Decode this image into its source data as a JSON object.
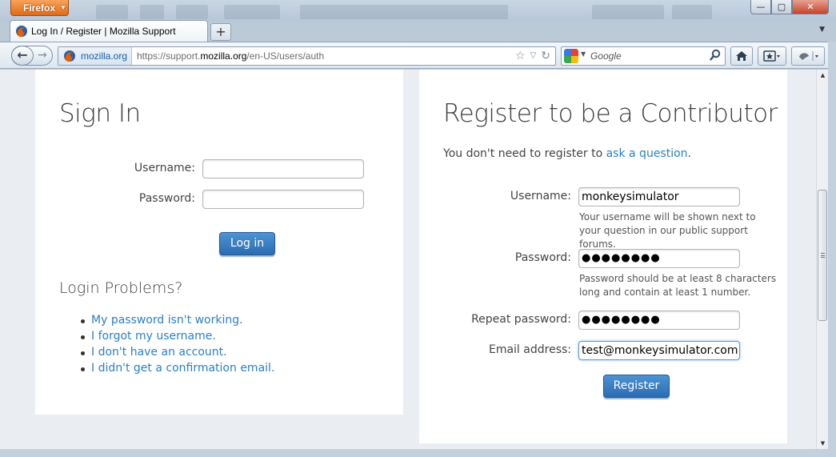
{
  "window": {
    "menu_label": "Firefox",
    "minimize": "—",
    "maximize": "▢",
    "close": "✕"
  },
  "tab": {
    "title": "Log In / Register | Mozilla Support",
    "new_tab": "+",
    "list_arrow": "▼"
  },
  "navbar": {
    "back": "←",
    "forward": "→",
    "identity": "mozilla.org",
    "url_prefix": "https://support.",
    "url_domain": "mozilla.org",
    "url_suffix": "/en-US/users/auth",
    "star": "☆",
    "history_drop": "▽",
    "reload": "↻",
    "search_placeholder": "Google",
    "search_drop": "▼",
    "search_go": "🔍"
  },
  "signin": {
    "title": "Sign In",
    "username_label": "Username:",
    "username_value": "",
    "password_label": "Password:",
    "password_value": "",
    "login_button": "Log in",
    "problems_title": "Login Problems?",
    "links": [
      "My password isn't working.",
      "I forgot my username.",
      "I don't have an account.",
      "I didn't get a confirmation email."
    ]
  },
  "register": {
    "title": "Register to be a Contributor",
    "intro_text": "You don't need to register to ",
    "intro_link": "ask a question",
    "intro_end": ".",
    "username_label": "Username:",
    "username_value": "monkeysimulator",
    "username_hint": "Your username will be shown next to your question in our public support forums.",
    "password_label": "Password:",
    "password_value": "●●●●●●●●",
    "password_hint": "Password should be at least 8 characters long and contain at least 1 number.",
    "repeat_label": "Repeat password:",
    "repeat_value": "●●●●●●●●",
    "email_label": "Email address:",
    "email_value": "test@monkeysimulator.com",
    "register_button": "Register"
  },
  "colors": {
    "link": "#2b7fc3",
    "button": "#3a7ec2",
    "firefox_orange": "#e66000"
  }
}
